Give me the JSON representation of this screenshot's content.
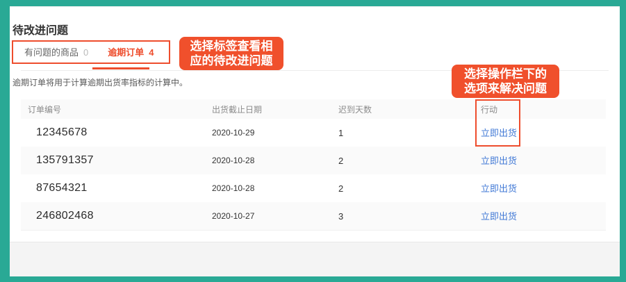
{
  "page": {
    "title": "待改进问题",
    "description": "逾期订单将用于计算逾期出货率指标的计算中。"
  },
  "tabs": [
    {
      "label": "有问题的商品",
      "count": "0",
      "active": false
    },
    {
      "label": "逾期订单",
      "count": "4",
      "active": true
    }
  ],
  "annotations": {
    "callout_tabs": {
      "line1": "选择标签查看相",
      "line2": "应的待改进问题"
    },
    "callout_action": {
      "line1": "选择操作栏下的",
      "line2": "选项来解决问题"
    }
  },
  "table": {
    "columns": [
      "订单编号",
      "出货截止日期",
      "迟到天数",
      "行动"
    ],
    "rows": [
      {
        "order_id": "12345678",
        "deadline": "2020-10-29",
        "days_late": "1",
        "action": "立即出货"
      },
      {
        "order_id": "135791357",
        "deadline": "2020-10-28",
        "days_late": "2",
        "action": "立即出货"
      },
      {
        "order_id": "87654321",
        "deadline": "2020-10-28",
        "days_late": "2",
        "action": "立即出货"
      },
      {
        "order_id": "246802468",
        "deadline": "2020-10-27",
        "days_late": "3",
        "action": "立即出货"
      }
    ]
  },
  "colors": {
    "frame": "#29a995",
    "accent": "#ee4d2d",
    "callout_background": "#f0502c",
    "link": "#4179d6"
  }
}
